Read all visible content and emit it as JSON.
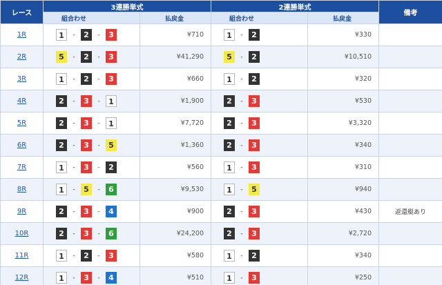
{
  "headers": {
    "race": "レース",
    "trifecta": "3連勝単式",
    "exacta": "2連勝単式",
    "note": "備考",
    "combo": "組合わせ",
    "payout": "払戻金"
  },
  "colors": {
    "1": "#ffffff",
    "2": "#333333",
    "3": "#e53935",
    "4": "#1e73d2",
    "5": "#f3e949",
    "6": "#2e9e3e",
    "header_bg": "#1d4fa0",
    "subheader_bg": "#dbe6f7"
  },
  "rows": [
    {
      "race": "1R",
      "tri": [
        "1",
        "2",
        "3"
      ],
      "tri_pay": "¥710",
      "ex": [
        "1",
        "2"
      ],
      "ex_pay": "¥330",
      "note": ""
    },
    {
      "race": "2R",
      "tri": [
        "5",
        "2",
        "3"
      ],
      "tri_pay": "¥41,290",
      "ex": [
        "5",
        "2"
      ],
      "ex_pay": "¥10,510",
      "note": ""
    },
    {
      "race": "3R",
      "tri": [
        "1",
        "2",
        "3"
      ],
      "tri_pay": "¥660",
      "ex": [
        "1",
        "2"
      ],
      "ex_pay": "¥320",
      "note": ""
    },
    {
      "race": "4R",
      "tri": [
        "2",
        "3",
        "1"
      ],
      "tri_pay": "¥1,900",
      "ex": [
        "2",
        "3"
      ],
      "ex_pay": "¥530",
      "note": ""
    },
    {
      "race": "5R",
      "tri": [
        "2",
        "3",
        "1"
      ],
      "tri_pay": "¥7,720",
      "ex": [
        "2",
        "3"
      ],
      "ex_pay": "¥3,320",
      "note": ""
    },
    {
      "race": "6R",
      "tri": [
        "2",
        "3",
        "5"
      ],
      "tri_pay": "¥1,360",
      "ex": [
        "2",
        "3"
      ],
      "ex_pay": "¥340",
      "note": ""
    },
    {
      "race": "7R",
      "tri": [
        "1",
        "3",
        "2"
      ],
      "tri_pay": "¥560",
      "ex": [
        "1",
        "3"
      ],
      "ex_pay": "¥310",
      "note": ""
    },
    {
      "race": "8R",
      "tri": [
        "1",
        "5",
        "6"
      ],
      "tri_pay": "¥9,530",
      "ex": [
        "1",
        "5"
      ],
      "ex_pay": "¥940",
      "note": ""
    },
    {
      "race": "9R",
      "tri": [
        "2",
        "3",
        "4"
      ],
      "tri_pay": "¥900",
      "ex": [
        "2",
        "3"
      ],
      "ex_pay": "¥430",
      "note": "返還艇あり"
    },
    {
      "race": "10R",
      "tri": [
        "2",
        "3",
        "6"
      ],
      "tri_pay": "¥24,200",
      "ex": [
        "2",
        "3"
      ],
      "ex_pay": "¥2,720",
      "note": ""
    },
    {
      "race": "11R",
      "tri": [
        "1",
        "2",
        "3"
      ],
      "tri_pay": "¥580",
      "ex": [
        "1",
        "2"
      ],
      "ex_pay": "¥340",
      "note": ""
    },
    {
      "race": "12R",
      "tri": [
        "1",
        "3",
        "4"
      ],
      "tri_pay": "¥510",
      "ex": [
        "1",
        "3"
      ],
      "ex_pay": "¥250",
      "note": ""
    }
  ]
}
